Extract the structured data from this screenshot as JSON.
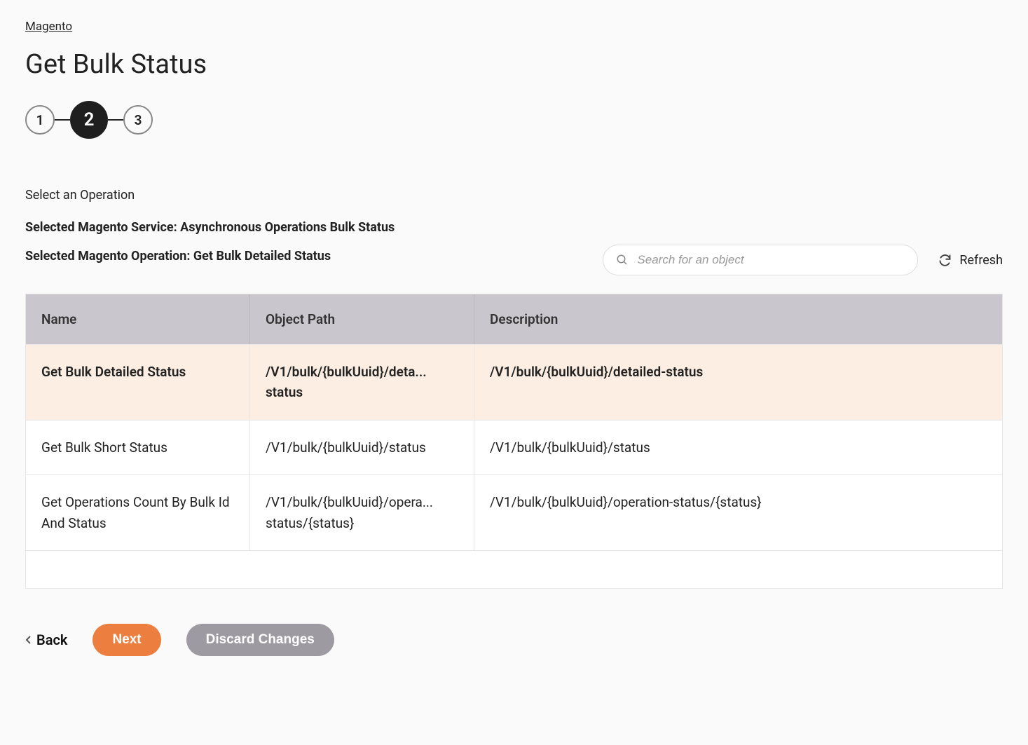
{
  "breadcrumb": "Magento",
  "title": "Get Bulk Status",
  "stepper": {
    "steps": [
      "1",
      "2",
      "3"
    ],
    "active": 1
  },
  "section_label": "Select an Operation",
  "selected_service": "Selected Magento Service: Asynchronous Operations Bulk Status",
  "selected_operation": "Selected Magento Operation: Get Bulk Detailed Status",
  "search": {
    "placeholder": "Search for an object"
  },
  "refresh_label": "Refresh",
  "columns": {
    "name": "Name",
    "path": "Object Path",
    "desc": "Description"
  },
  "rows": [
    {
      "name": "Get Bulk Detailed Status",
      "path": "/V1/bulk/{bulkUuid}/deta... status",
      "desc": "/V1/bulk/{bulkUuid}/detailed-status",
      "selected": true
    },
    {
      "name": "Get Bulk Short Status",
      "path": "/V1/bulk/{bulkUuid}/status",
      "desc": "/V1/bulk/{bulkUuid}/status",
      "selected": false
    },
    {
      "name": "Get Operations Count By Bulk Id And Status",
      "path": "/V1/bulk/{bulkUuid}/opera... status/{status}",
      "desc": "/V1/bulk/{bulkUuid}/operation-status/{status}",
      "selected": false
    }
  ],
  "actions": {
    "back": "Back",
    "next": "Next",
    "discard": "Discard Changes"
  }
}
